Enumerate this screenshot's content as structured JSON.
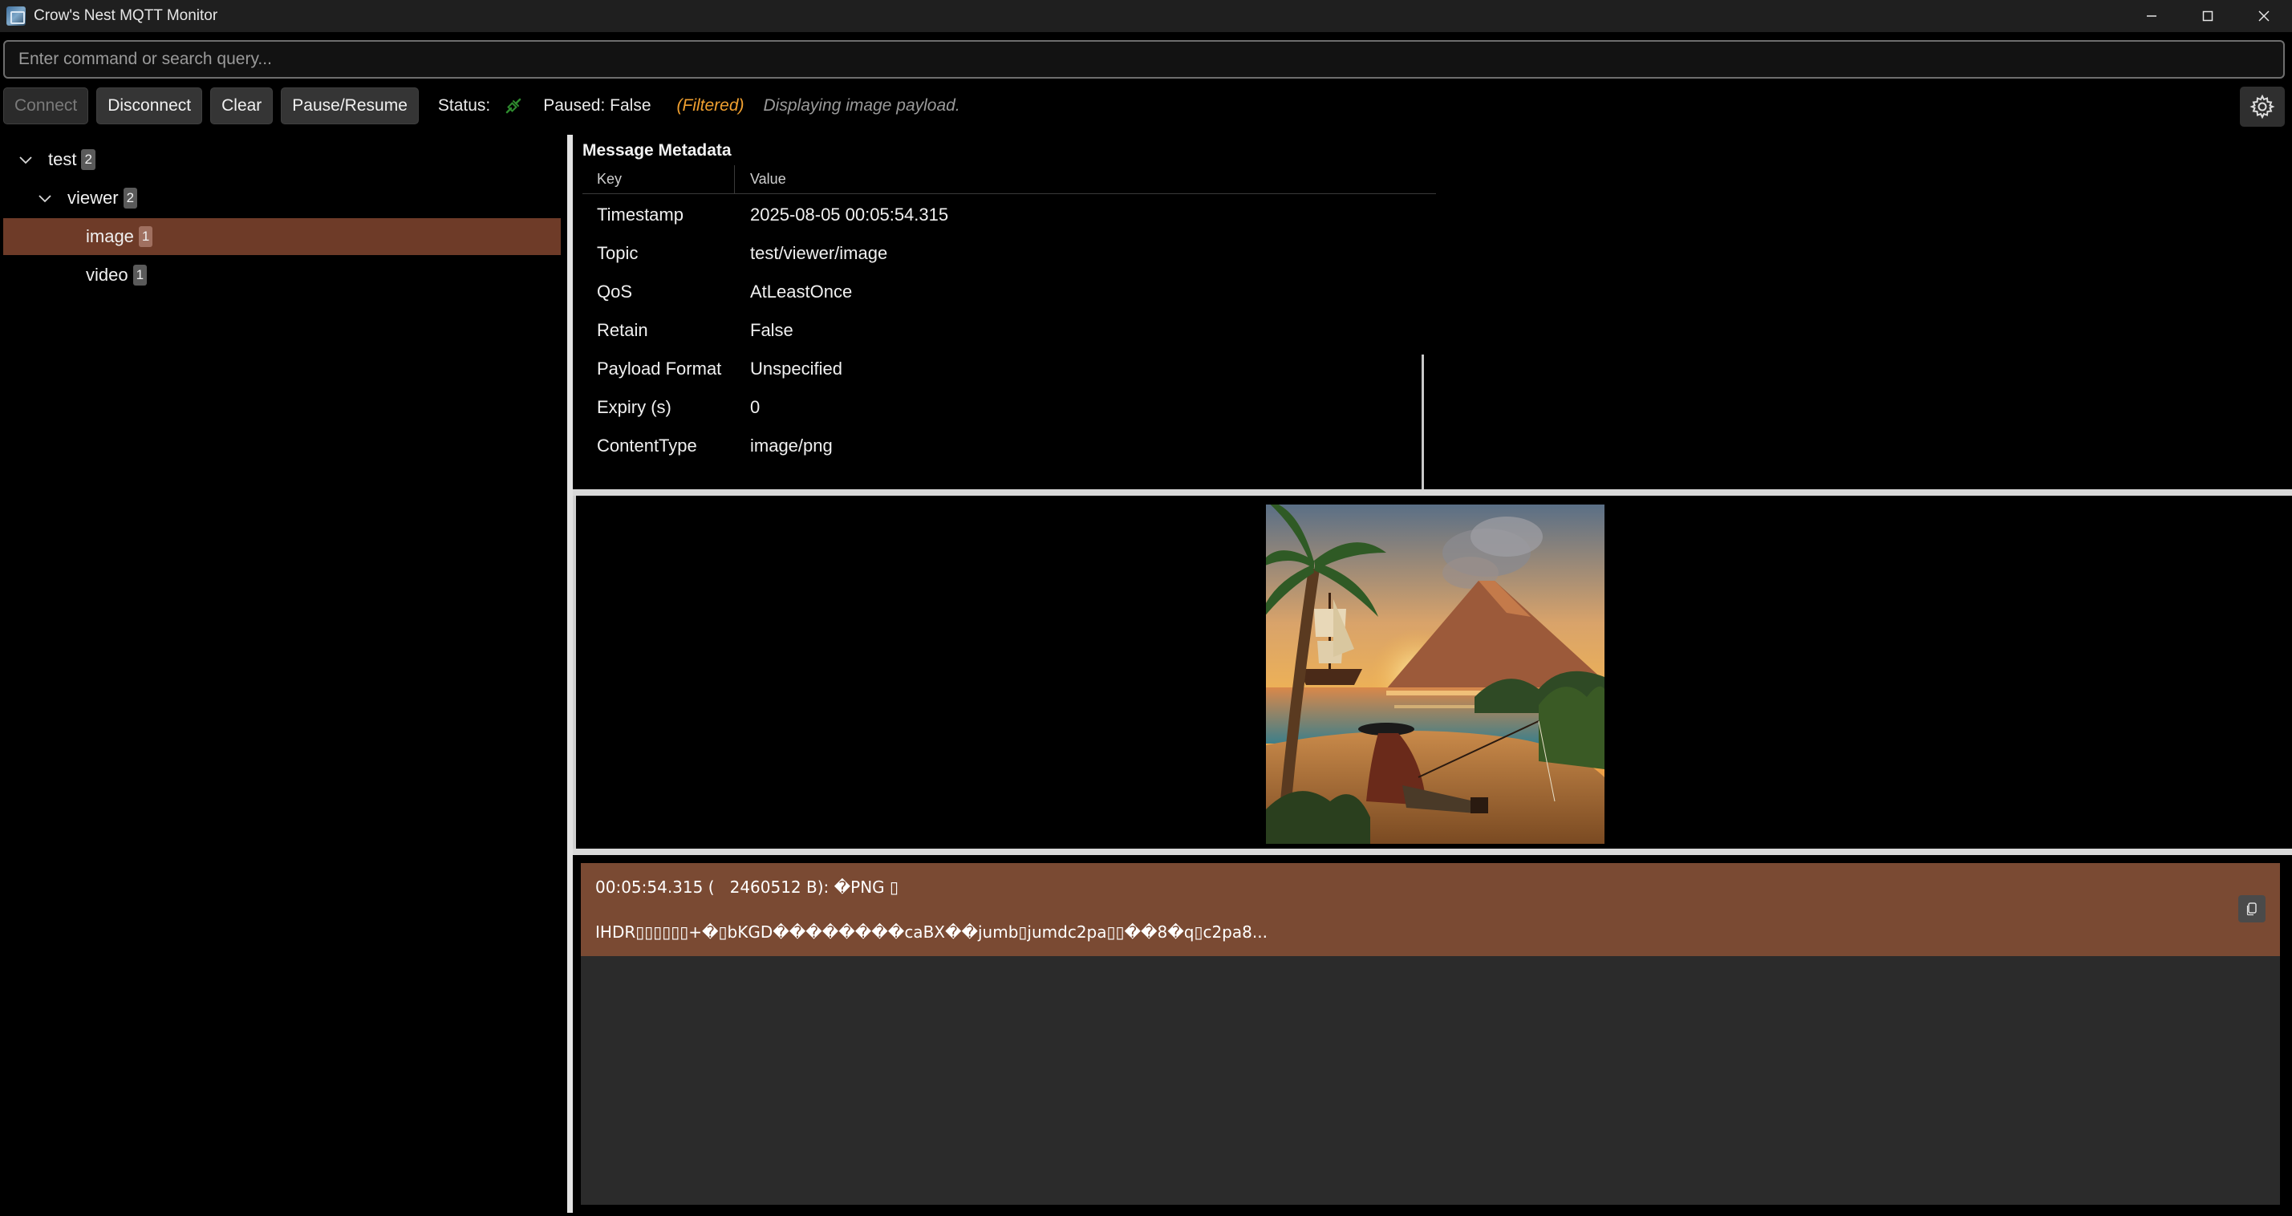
{
  "window": {
    "title": "Crow's Nest MQTT Monitor",
    "controls": [
      "minimize-icon",
      "maximize-icon",
      "close-icon"
    ]
  },
  "command": {
    "placeholder": "Enter command or search query...",
    "value": ""
  },
  "toolbar": {
    "connect_label": "Connect",
    "disconnect_label": "Disconnect",
    "clear_label": "Clear",
    "pause_resume_label": "Pause/Resume",
    "status_label": "Status:",
    "status_icon": "connected-plug-icon",
    "paused_text": "Paused: False",
    "filtered_text": "(Filtered)",
    "info_text": "Displaying image payload.",
    "settings_icon": "gear-icon"
  },
  "tree": {
    "items": [
      {
        "label": "test",
        "count": "2",
        "expanded": true,
        "level": 0
      },
      {
        "label": "viewer",
        "count": "2",
        "expanded": true,
        "level": 1
      },
      {
        "label": "image",
        "count": "1",
        "selected": true,
        "level": 2
      },
      {
        "label": "video",
        "count": "1",
        "level": 2
      }
    ]
  },
  "metadata": {
    "title": "Message Metadata",
    "headers": {
      "key": "Key",
      "value": "Value"
    },
    "rows": [
      {
        "key": "Timestamp",
        "value": "2025-08-05 00:05:54.315"
      },
      {
        "key": "Topic",
        "value": "test/viewer/image"
      },
      {
        "key": "QoS",
        "value": "AtLeastOnce"
      },
      {
        "key": "Retain",
        "value": "False"
      },
      {
        "key": "Payload Format",
        "value": "Unspecified"
      },
      {
        "key": "Expiry (s)",
        "value": "0"
      },
      {
        "key": "ContentType",
        "value": "image/png"
      }
    ]
  },
  "image_preview": {
    "description_icon": "pirate-beach-image"
  },
  "payload": {
    "line1": "00:05:54.315 (   2460512 B): �PNG ▯",
    "line2": "IHDR▯▯▯▯▯▯+�▯bKGD��������caBX��jumb▯jumdc2pa▯▯��8�q▯c2pa8...",
    "copy_icon": "copy-icon"
  },
  "colors": {
    "selection": "#6e3b28",
    "payload_selection": "#7a4a33",
    "filtered": "#f0a030",
    "status_ok": "#2e8b2e"
  }
}
